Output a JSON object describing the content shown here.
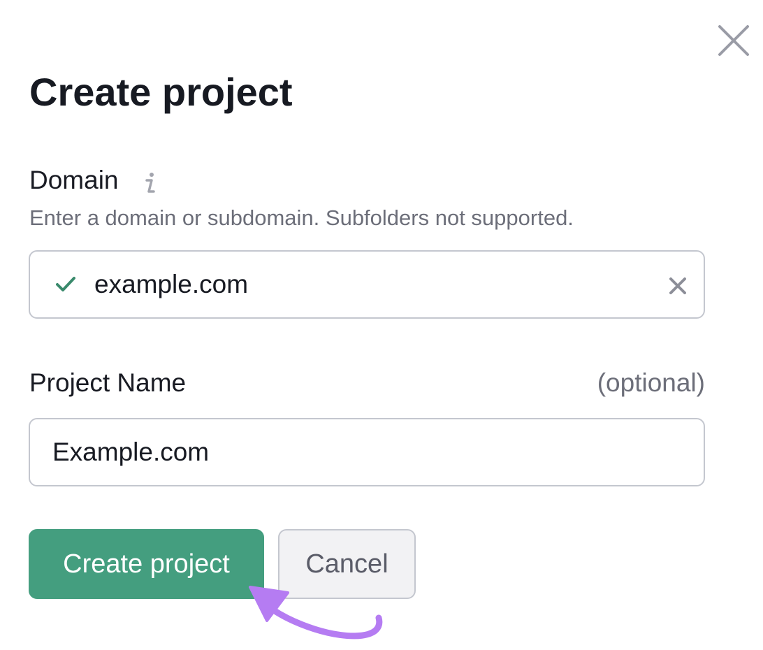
{
  "dialog": {
    "title": "Create project",
    "close_icon": "close-icon"
  },
  "domain": {
    "label": "Domain",
    "info_icon": "info-icon",
    "hint": "Enter a domain or subdomain. Subfolders not supported.",
    "value": "example.com",
    "status_icon": "check-icon",
    "status_color": "#3a8a6c",
    "clear_icon": "clear-icon"
  },
  "project_name": {
    "label": "Project Name",
    "optional_text": "(optional)",
    "value": "Example.com"
  },
  "actions": {
    "create_label": "Create project",
    "cancel_label": "Cancel"
  },
  "colors": {
    "primary": "#449e7f",
    "annotation_arrow": "#b57cf2",
    "border": "#c4c7cf",
    "muted_text": "#6c6e79"
  }
}
